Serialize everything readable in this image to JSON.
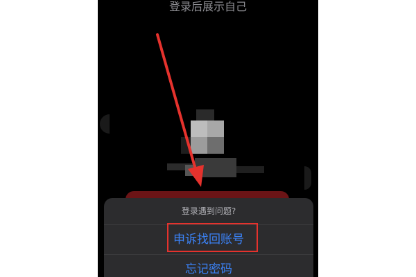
{
  "screen": {
    "title": "登录后展示自己"
  },
  "action_sheet": {
    "header": "登录遇到问题?",
    "options": [
      {
        "label": "申诉找回账号",
        "highlighted": true
      },
      {
        "label": "忘记密码",
        "highlighted": false
      }
    ]
  },
  "colors": {
    "background": "#000000",
    "sheet": "#2c2c2e",
    "option_text": "#3b82f6",
    "annotation": "#e5322d"
  },
  "icons": {
    "avatar": "pixelated-avatar-icon",
    "annotation_arrow": "red-arrow-icon"
  }
}
